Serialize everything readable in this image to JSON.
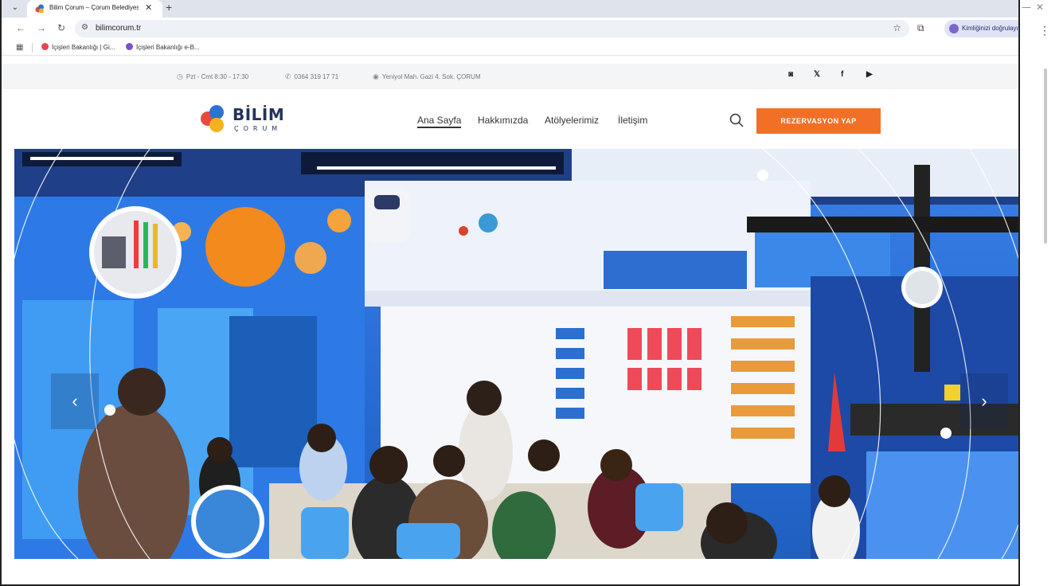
{
  "browser": {
    "tab_title": "Bilim Çorum – Çorum Belediyesi",
    "tab_close": "✕",
    "new_tab": "+",
    "url": "bilimcorum.tr",
    "profile_label": "Kimliğinizi doğrulayın",
    "bookmarks": [
      {
        "label": "İçişleri Bakanlığı | Gi..."
      },
      {
        "label": "İçişleri Bakanlığı e-B..."
      }
    ]
  },
  "topbar": {
    "hours": "Pzt - Cmt 8:30 - 17:30",
    "phone": "0364 319 17 71",
    "address": "Yeniyol Mah. Gazi 4. Sok. ÇORUM"
  },
  "header": {
    "logo_main": "BİLİM",
    "logo_sub": "ÇORUM",
    "nav": [
      {
        "label": "Ana Sayfa"
      },
      {
        "label": "Hakkımızda"
      },
      {
        "label": "Atölyelerimiz"
      },
      {
        "label": "İletişim"
      }
    ],
    "cta_label": "REZERVASYON YAP"
  },
  "hero": {
    "prev": "‹",
    "next": "›"
  },
  "colors": {
    "accent": "#f26f27",
    "brand_navy": "#24335a",
    "hero_blue": "#2a6fd7"
  }
}
